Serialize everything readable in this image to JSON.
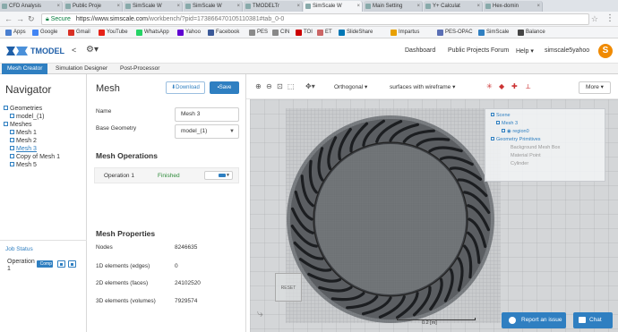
{
  "browser": {
    "tabs": [
      "CFD Analysis",
      "Public Proje",
      "SimScale W",
      "SimScale W",
      "TMODELTr",
      "SimScale W",
      "Main Setting",
      "Y+ Calculat",
      "Hex-domin"
    ],
    "secure_label": "Secure",
    "url_host": "https://www.simscale.com",
    "url_path": "/workbench/?pid=173866470105110381#tab_0-0",
    "bookmarks": [
      "Apps",
      "Google",
      "Gmail",
      "YouTube",
      "WhatsApp",
      "Yahoo",
      "Facebook",
      "PES",
      "CIN",
      "TOI",
      "ET",
      "SlideShare",
      "Impartus",
      "PES-OPAC",
      "SimScale",
      "Balance"
    ]
  },
  "header": {
    "brand": "TMODEL",
    "nav": [
      "Dashboard",
      "Public Projects",
      "Forum",
      "Help"
    ],
    "user": "simscale5yahoo",
    "avatar_letter": "S"
  },
  "module_tabs": [
    "Mesh Creator",
    "Simulation Designer",
    "Post-Processor"
  ],
  "navigator": {
    "title": "Navigator",
    "tree": {
      "geometries": "Geometries",
      "model": "model_(1)",
      "meshes": "Meshes",
      "mesh_items": [
        "Mesh 1",
        "Mesh 2",
        "Mesh 3",
        "Copy of Mesh 1",
        "Mesh 5"
      ]
    },
    "job_status": {
      "title": "Job Status",
      "name": "Operation 1",
      "bar_text": "Comp"
    }
  },
  "mesh": {
    "title": "Mesh",
    "download_label": "Download",
    "save_label": "Save",
    "name_label": "Name",
    "name_value": "Mesh 3",
    "base_geometry_label": "Base Geometry",
    "base_geometry_value": "model_(1)",
    "operations_title": "Mesh Operations",
    "operation_name": "Operation 1",
    "operation_status": "Finished",
    "properties_title": "Mesh Properties",
    "properties": [
      {
        "label": "Nodes",
        "value": "8246635"
      },
      {
        "label": "1D elements (edges)",
        "value": "0"
      },
      {
        "label": "2D elements (faces)",
        "value": "24102520"
      },
      {
        "label": "3D elements (volumes)",
        "value": "7929574"
      }
    ]
  },
  "viewer": {
    "projection": "Orthogonal",
    "render_mode": "surfaces with wireframe",
    "more_label": "More",
    "scene_tree": {
      "scene": "Scene",
      "mesh": "Mesh 3",
      "region": "region0",
      "primitives": "Geometry Primitives",
      "items": [
        "Background Mesh Box",
        "Material Point",
        "Cylinder"
      ]
    },
    "scale_text": "0.2 [m]",
    "reset_label": "RESET"
  },
  "footer": {
    "report_label": "Report an issue",
    "chat_label": "Chat"
  },
  "colors": {
    "accent": "#2f7fc1",
    "success": "#2e8b3a",
    "avatar": "#f08a00"
  }
}
